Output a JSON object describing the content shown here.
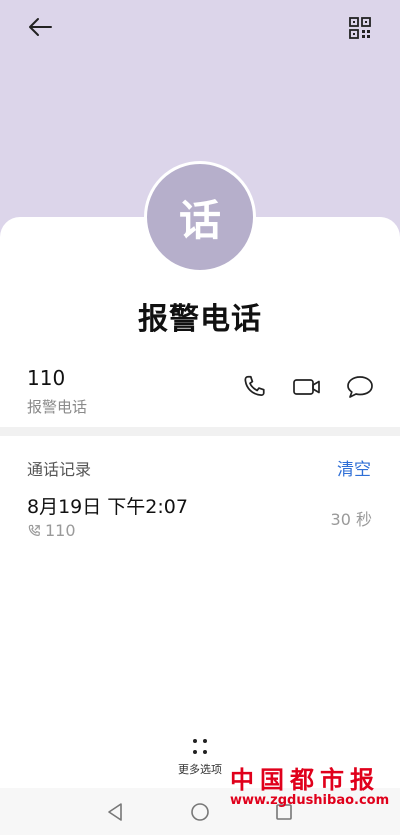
{
  "contact": {
    "avatar_char": "话",
    "name": "报警电话",
    "number": "110",
    "number_label": "报警电话"
  },
  "icons": {
    "back": "back-arrow-icon",
    "qr": "qr-code-icon",
    "call": "phone-icon",
    "video": "video-call-icon",
    "message": "message-icon"
  },
  "call_log": {
    "title": "通话记录",
    "clear_label": "清空",
    "entries": [
      {
        "datetime": "8月19日 下午2:07",
        "number": "110",
        "duration": "30 秒"
      }
    ]
  },
  "more_options": {
    "label": "更多选项"
  },
  "watermark": {
    "brand": "中国都市报",
    "url": "www.zgdushibao.com"
  },
  "colors": {
    "header_bg": "#dcd5ea",
    "avatar_bg": "#b6afcb",
    "accent": "#2f6fd6",
    "watermark": "#e0001b"
  }
}
